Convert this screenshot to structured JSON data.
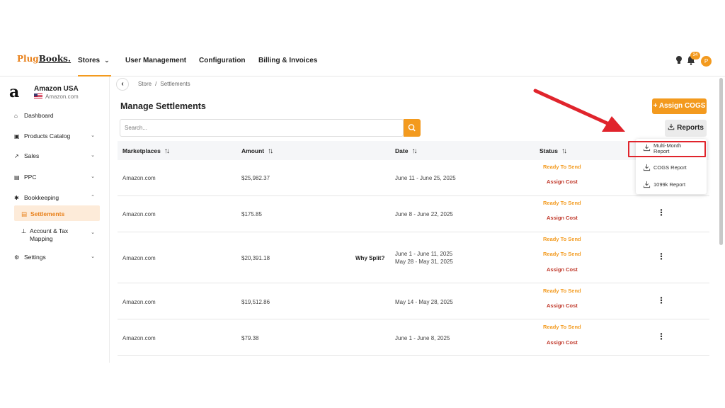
{
  "colors": {
    "accent": "#f39a1e",
    "danger": "#c0392b",
    "annotation": "#e0242c"
  },
  "nav": {
    "logo_part1": "Plug",
    "logo_part2": "Books.",
    "items": [
      {
        "label": "Stores"
      },
      {
        "label": "User Management"
      },
      {
        "label": "Configuration"
      },
      {
        "label": "Billing & Invoices"
      }
    ],
    "notification_count": "34",
    "avatar_initial": "P"
  },
  "sidebar": {
    "store_name": "Amazon USA",
    "store_domain": "Amazon.com",
    "items": [
      {
        "label": "Dashboard",
        "icon": "home-icon"
      },
      {
        "label": "Products Catalog",
        "icon": "catalog-icon"
      },
      {
        "label": "Sales",
        "icon": "chart-icon"
      },
      {
        "label": "PPC",
        "icon": "ppc-icon"
      },
      {
        "label": "Bookkeeping",
        "icon": "bookkeeping-icon"
      },
      {
        "label": "Settings",
        "icon": "gear-icon"
      }
    ],
    "sub_items": [
      {
        "label": "Settlements"
      },
      {
        "label": "Account & Tax Mapping"
      }
    ]
  },
  "breadcrumb": {
    "store": "Store",
    "sep": "/",
    "current": "Settlements"
  },
  "page": {
    "title": "Manage Settlements",
    "search_placeholder": "Search...",
    "assign_cogs_label": "+ Assign COGS",
    "reports_label": "Reports"
  },
  "table": {
    "headers": [
      "Marketplaces",
      "Amount",
      "Date",
      "Status"
    ],
    "rows": [
      {
        "marketplace": "Amazon.com",
        "amount": "$25,982.37",
        "date1": "June 11 - June 25, 2025",
        "status1": "Ready To Send",
        "status2": "Assign Cost"
      },
      {
        "marketplace": "Amazon.com",
        "amount": "$175.85",
        "date1": "June 8 - June 22, 2025",
        "status1": "Ready To Send",
        "status2": "Assign Cost"
      },
      {
        "marketplace": "Amazon.com",
        "amount": "$20,391.18",
        "split_label": "Why Split?",
        "date1": "June 1 - June 11, 2025",
        "date2": "May 28 - May 31, 2025",
        "status0": "Ready To Send",
        "status1": "Ready To Send",
        "status2": "Assign Cost"
      },
      {
        "marketplace": "Amazon.com",
        "amount": "$19,512.86",
        "date1": "May 14 - May 28, 2025",
        "status1": "Ready To Send",
        "status2": "Assign Cost"
      },
      {
        "marketplace": "Amazon.com",
        "amount": "$79.38",
        "date1": "June 1 - June 8, 2025",
        "status1": "Ready To Send",
        "status2": "Assign Cost"
      }
    ]
  },
  "reports_menu": {
    "multi_month_line1": "Multi-Month",
    "multi_month_line2": "Report",
    "cogs": "COGS Report",
    "k1099": "1099k Report"
  }
}
